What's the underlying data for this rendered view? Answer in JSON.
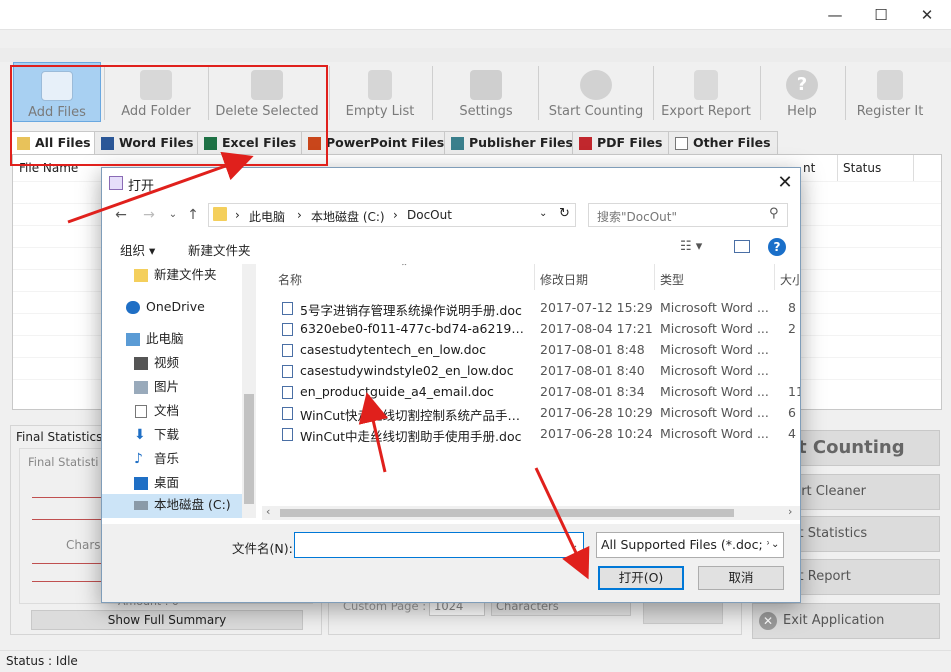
{
  "window": {
    "minimize": "—",
    "maximize": "☐",
    "close": "✕"
  },
  "toolbar": {
    "buttons": [
      {
        "label": "Add Files",
        "icon": "add-files-icon"
      },
      {
        "label": "Add Folder",
        "icon": "folder-icon"
      },
      {
        "label": "Delete Selected",
        "icon": "delete-icon"
      },
      {
        "label": "Empty List",
        "icon": "trash-icon"
      },
      {
        "label": "Settings",
        "icon": "wrench-icon"
      },
      {
        "label": "Start Counting",
        "icon": "gear-icon"
      },
      {
        "label": "Export Report",
        "icon": "document-icon"
      },
      {
        "label": "Help",
        "icon": "help-icon"
      },
      {
        "label": "Register It",
        "icon": "notepad-icon"
      }
    ]
  },
  "tabs": [
    "All Files",
    "Word Files",
    "Excel Files",
    "PowerPoint Files",
    "Publisher Files",
    "PDF Files",
    "Other Files"
  ],
  "list": {
    "col_name": "File Name",
    "col_count": "nt",
    "col_status": "Status"
  },
  "final": {
    "title": "Final Statistics",
    "group": "Final Statisti",
    "chars": "Chars",
    "c": "C",
    "amount": "Amount : 0",
    "show_summary": "Show Full Summary",
    "custom_page": "Custom Page :",
    "custom_page_value": "1024",
    "characters": "Characters"
  },
  "right_buttons": {
    "start": "art Counting",
    "cleaner": "eport Cleaner",
    "statistics": "port Statistics",
    "report": "port Report",
    "exit": "Exit Application"
  },
  "status": "Status : Idle",
  "dialog": {
    "title": "打开",
    "path": [
      "此电脑",
      "本地磁盘 (C:)",
      "DocOut"
    ],
    "search_placeholder": "搜索\"DocOut\"",
    "organize": "组织 ▾",
    "new_folder": "新建文件夹",
    "nav": [
      {
        "label": "新建文件夹",
        "icon": "folder-icon"
      },
      {
        "label": "OneDrive",
        "icon": "cloud-icon"
      },
      {
        "label": "此电脑",
        "icon": "computer-icon"
      },
      {
        "label": "视频",
        "icon": "video-icon"
      },
      {
        "label": "图片",
        "icon": "picture-icon"
      },
      {
        "label": "文档",
        "icon": "document-icon"
      },
      {
        "label": "下载",
        "icon": "download-icon"
      },
      {
        "label": "音乐",
        "icon": "music-icon"
      },
      {
        "label": "桌面",
        "icon": "desktop-icon"
      },
      {
        "label": "本地磁盘 (C:)",
        "icon": "drive-icon"
      }
    ],
    "columns": {
      "name": "名称",
      "date": "修改日期",
      "type": "类型",
      "size": "大小"
    },
    "files": [
      {
        "name": "5号字进销存管理系统操作说明手册.doc",
        "date": "2017-07-12 15:29",
        "type": "Microsoft Word ...",
        "size": "8"
      },
      {
        "name": "6320ebe0-f011-477c-bd74-a6219d56...",
        "date": "2017-08-04 17:21",
        "type": "Microsoft Word ...",
        "size": "2"
      },
      {
        "name": "casestudytentech_en_low.doc",
        "date": "2017-08-01 8:48",
        "type": "Microsoft Word ...",
        "size": ""
      },
      {
        "name": "casestudywindstyle02_en_low.doc",
        "date": "2017-08-01 8:40",
        "type": "Microsoft Word ...",
        "size": ""
      },
      {
        "name": "en_productguide_a4_email.doc",
        "date": "2017-08-01 8:34",
        "type": "Microsoft Word ...",
        "size": "11"
      },
      {
        "name": "WinCut快走丝线切割控制系统产品手册...",
        "date": "2017-06-28 10:29",
        "type": "Microsoft Word ...",
        "size": "6"
      },
      {
        "name": "WinCut中走丝线切割助手使用手册.doc",
        "date": "2017-06-28 10:24",
        "type": "Microsoft Word ...",
        "size": "4"
      }
    ],
    "filename_label": "文件名(N):",
    "filename_value": "",
    "filter": "All Supported Files  (*.doc; *",
    "open": "打开(O)",
    "cancel": "取消"
  },
  "colors": {
    "annotation": "#e0201c",
    "accent": "#0078d7",
    "active_tool": "#a8d0f2"
  }
}
